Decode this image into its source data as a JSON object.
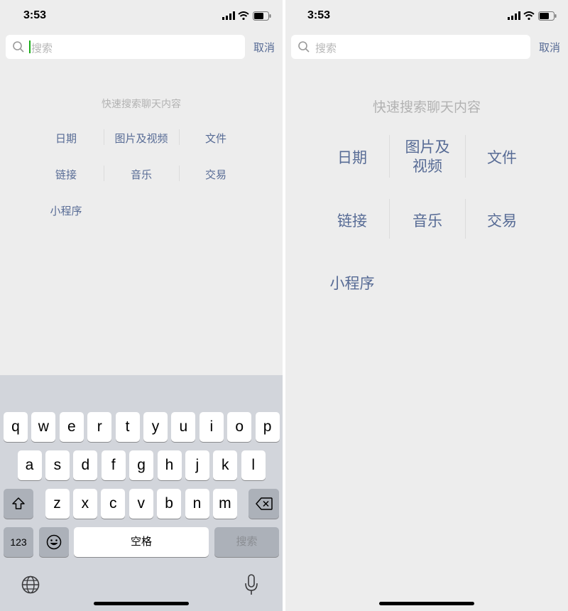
{
  "status": {
    "time": "3:53"
  },
  "search": {
    "placeholder": "搜索",
    "cancel": "取消"
  },
  "hint": "快速搜索聊天内容",
  "categories": {
    "date": "日期",
    "media": "图片及视频",
    "media_line1": "图片及",
    "media_line2": "视频",
    "file": "文件",
    "link": "链接",
    "music": "音乐",
    "trade": "交易",
    "miniprogram": "小程序"
  },
  "keyboard": {
    "row1": [
      "q",
      "w",
      "e",
      "r",
      "t",
      "y",
      "u",
      "i",
      "o",
      "p"
    ],
    "row2": [
      "a",
      "s",
      "d",
      "f",
      "g",
      "h",
      "j",
      "k",
      "l"
    ],
    "row3": [
      "z",
      "x",
      "c",
      "v",
      "b",
      "n",
      "m"
    ],
    "numbers": "123",
    "space": "空格",
    "search": "搜索",
    "icons": [
      "shift-icon",
      "delete-icon",
      "emoji-icon",
      "globe-icon",
      "microphone-icon"
    ]
  },
  "colors": {
    "link": "#576b95",
    "background": "#ededed",
    "keyboard": "#d2d5db",
    "caret": "#1aad19"
  }
}
